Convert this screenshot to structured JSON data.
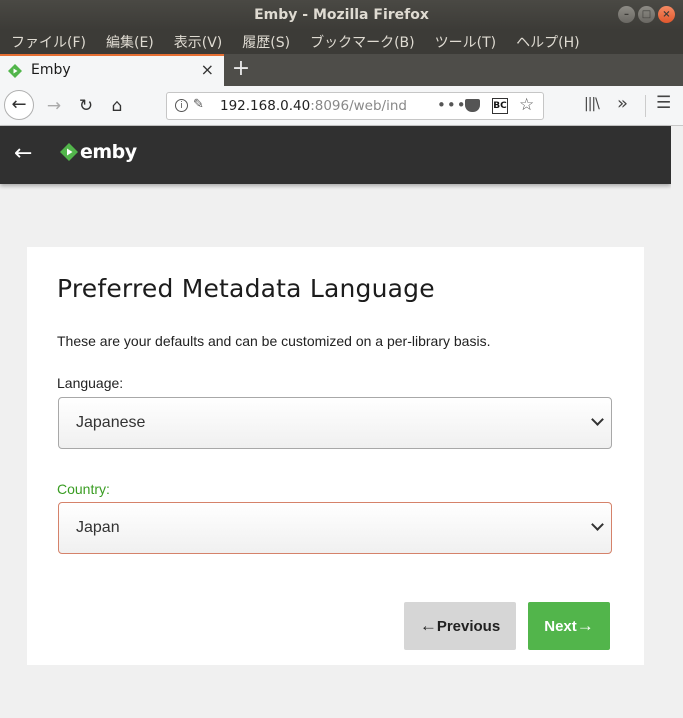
{
  "window": {
    "title": "Emby - Mozilla Firefox",
    "controls": [
      "minimize-icon",
      "maximize-icon",
      "close-icon"
    ]
  },
  "menubar": {
    "items": [
      "ファイル(F)",
      "編集(E)",
      "表示(V)",
      "履歴(S)",
      "ブックマーク(B)",
      "ツール(T)",
      "ヘルプ(H)"
    ]
  },
  "tabs": [
    {
      "title": "Emby",
      "close": "×",
      "active": true
    }
  ],
  "newtab": "+",
  "navbar": {
    "back": "←",
    "forward": "→",
    "reload": "↻",
    "home": "⌂",
    "url_host": "192.168.0.40",
    "url_rest": ":8096/web/ind",
    "page_actions": "•••",
    "extension_label": "BC",
    "star": "☆",
    "library": "|||\\",
    "overflow": "»",
    "menu": "☰"
  },
  "emby": {
    "back": "←",
    "brand": "emby",
    "brand_color": "#52b54b"
  },
  "wizard": {
    "heading": "Preferred Metadata Language",
    "description": "These are your defaults and can be customized on a per-library basis.",
    "language_label": "Language:",
    "language_value": "Japanese",
    "country_label": "Country:",
    "country_value": "Japan",
    "previous_label": "Previous",
    "next_label": "Next"
  },
  "colors": {
    "accent": "#52b54b",
    "header_bg": "#303030",
    "tab_highlight": "#e66f33"
  }
}
